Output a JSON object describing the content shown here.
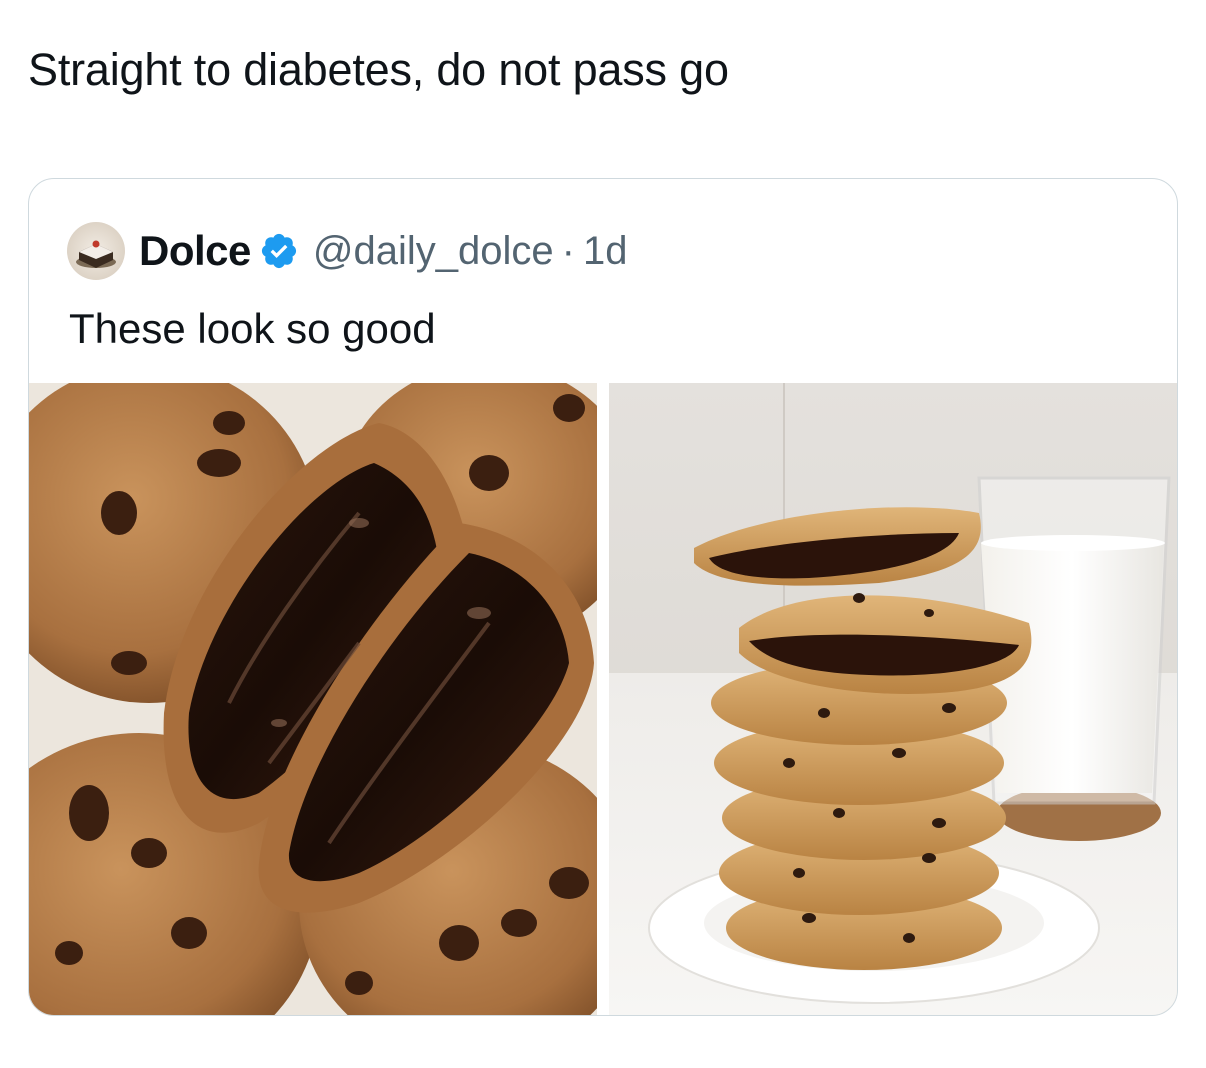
{
  "post": {
    "text": "Straight to diabetes, do not pass go"
  },
  "quoted": {
    "author": {
      "display_name": "Dolce",
      "handle": "@daily_dolce",
      "verified": true
    },
    "separator": "·",
    "time": "1d",
    "text": "These look so good",
    "images": [
      {
        "name": "cookies-molten-chocolate-image"
      },
      {
        "name": "cookie-stack-with-milk-image"
      }
    ]
  },
  "colors": {
    "text": "#0f1419",
    "secondary": "#536471",
    "verified": "#1d9bf0",
    "border": "#cfd9de"
  }
}
